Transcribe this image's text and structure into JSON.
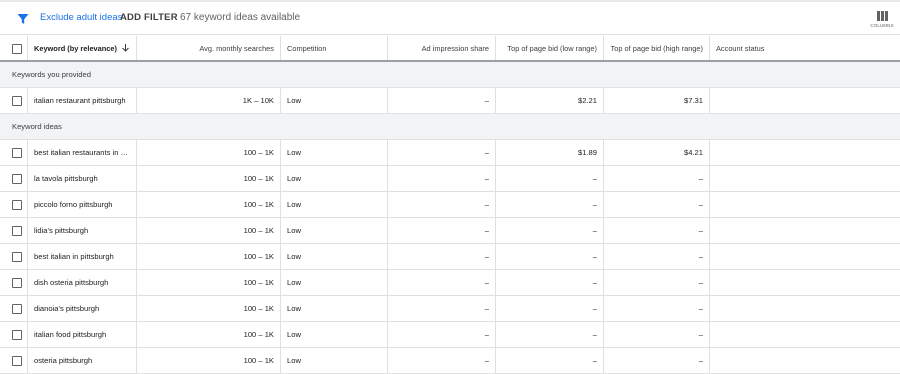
{
  "toolbar": {
    "exclude_label": "Exclude adult ideas",
    "add_filter_label": "ADD FILTER",
    "idea_count": "67 keyword ideas available",
    "columns_label": "COLUMNS"
  },
  "table": {
    "headers": {
      "keyword": "Keyword (by relevance)",
      "avg": "Avg. monthly searches",
      "competition": "Competition",
      "impression": "Ad impression share",
      "bid_low": "Top of page bid (low range)",
      "bid_high": "Top of page bid (high range)",
      "status": "Account status"
    },
    "groups": {
      "provided": "Keywords you provided",
      "ideas": "Keyword ideas"
    },
    "provided_rows": [
      {
        "keyword": "italian restaurant pittsburgh",
        "avg": "1K – 10K",
        "competition": "Low",
        "impression": "–",
        "bid_low": "$2.21",
        "bid_high": "$7.31",
        "status": ""
      }
    ],
    "idea_rows": [
      {
        "keyword": "best italian restaurants in p...",
        "avg": "100 – 1K",
        "competition": "Low",
        "impression": "–",
        "bid_low": "$1.89",
        "bid_high": "$4.21",
        "status": ""
      },
      {
        "keyword": "la tavola pittsburgh",
        "avg": "100 – 1K",
        "competition": "Low",
        "impression": "–",
        "bid_low": "–",
        "bid_high": "–",
        "status": ""
      },
      {
        "keyword": "piccolo forno pittsburgh",
        "avg": "100 – 1K",
        "competition": "Low",
        "impression": "–",
        "bid_low": "–",
        "bid_high": "–",
        "status": ""
      },
      {
        "keyword": "lidia's pittsburgh",
        "avg": "100 – 1K",
        "competition": "Low",
        "impression": "–",
        "bid_low": "–",
        "bid_high": "–",
        "status": ""
      },
      {
        "keyword": "best italian in pittsburgh",
        "avg": "100 – 1K",
        "competition": "Low",
        "impression": "–",
        "bid_low": "–",
        "bid_high": "–",
        "status": ""
      },
      {
        "keyword": "dish osteria pittsburgh",
        "avg": "100 – 1K",
        "competition": "Low",
        "impression": "–",
        "bid_low": "–",
        "bid_high": "–",
        "status": ""
      },
      {
        "keyword": "dianoia's pittsburgh",
        "avg": "100 – 1K",
        "competition": "Low",
        "impression": "–",
        "bid_low": "–",
        "bid_high": "–",
        "status": ""
      },
      {
        "keyword": "italian food pittsburgh",
        "avg": "100 – 1K",
        "competition": "Low",
        "impression": "–",
        "bid_low": "–",
        "bid_high": "–",
        "status": ""
      },
      {
        "keyword": "osteria pittsburgh",
        "avg": "100 – 1K",
        "competition": "Low",
        "impression": "–",
        "bid_low": "–",
        "bid_high": "–",
        "status": ""
      }
    ]
  },
  "colors": {
    "accent": "#1a73e8",
    "group_bg": "#f1f3f4",
    "border": "#e0e0e0"
  },
  "icons": [
    "filter-icon",
    "columns-icon",
    "sort-down-arrow-icon",
    "checkbox"
  ]
}
